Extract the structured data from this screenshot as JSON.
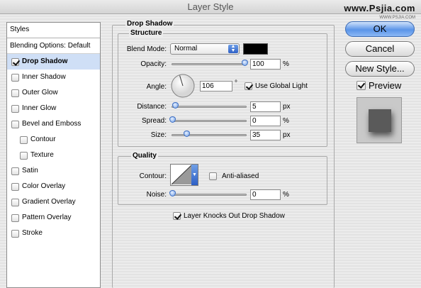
{
  "window": {
    "title": "Layer Style"
  },
  "watermark": {
    "text": "www.Psjia.com",
    "sub": "WWW.PSJIA.COM"
  },
  "styles": {
    "header": "Styles",
    "blending_options": "Blending Options: Default",
    "items": [
      {
        "label": "Drop Shadow",
        "checked": true
      },
      {
        "label": "Inner Shadow",
        "checked": false
      },
      {
        "label": "Outer Glow",
        "checked": false
      },
      {
        "label": "Inner Glow",
        "checked": false
      },
      {
        "label": "Bevel and Emboss",
        "checked": false
      },
      {
        "label": "Contour",
        "checked": false
      },
      {
        "label": "Texture",
        "checked": false
      },
      {
        "label": "Satin",
        "checked": false
      },
      {
        "label": "Color Overlay",
        "checked": false
      },
      {
        "label": "Gradient Overlay",
        "checked": false
      },
      {
        "label": "Pattern Overlay",
        "checked": false
      },
      {
        "label": "Stroke",
        "checked": false
      }
    ]
  },
  "drop_shadow": {
    "title": "Drop Shadow",
    "structure": {
      "title": "Structure",
      "blend_mode_label": "Blend Mode:",
      "blend_mode_value": "Normal",
      "shadow_color": "#000000",
      "opacity_label": "Opacity:",
      "opacity_value": "100",
      "opacity_unit": "%",
      "angle_label": "Angle:",
      "angle_value": "106",
      "angle_unit": "°",
      "use_global_light_label": "Use Global Light",
      "use_global_light": true,
      "distance_label": "Distance:",
      "distance_value": "5",
      "distance_unit": "px",
      "spread_label": "Spread:",
      "spread_value": "0",
      "spread_unit": "%",
      "size_label": "Size:",
      "size_value": "35",
      "size_unit": "px"
    },
    "quality": {
      "title": "Quality",
      "contour_label": "Contour:",
      "anti_aliased_label": "Anti-aliased",
      "anti_aliased": false,
      "noise_label": "Noise:",
      "noise_value": "0",
      "noise_unit": "%"
    },
    "layer_knocks_out_label": "Layer Knocks Out Drop Shadow",
    "layer_knocks_out": true
  },
  "buttons": {
    "ok": "OK",
    "cancel": "Cancel",
    "new_style": "New Style...",
    "preview_label": "Preview",
    "preview_checked": true
  }
}
